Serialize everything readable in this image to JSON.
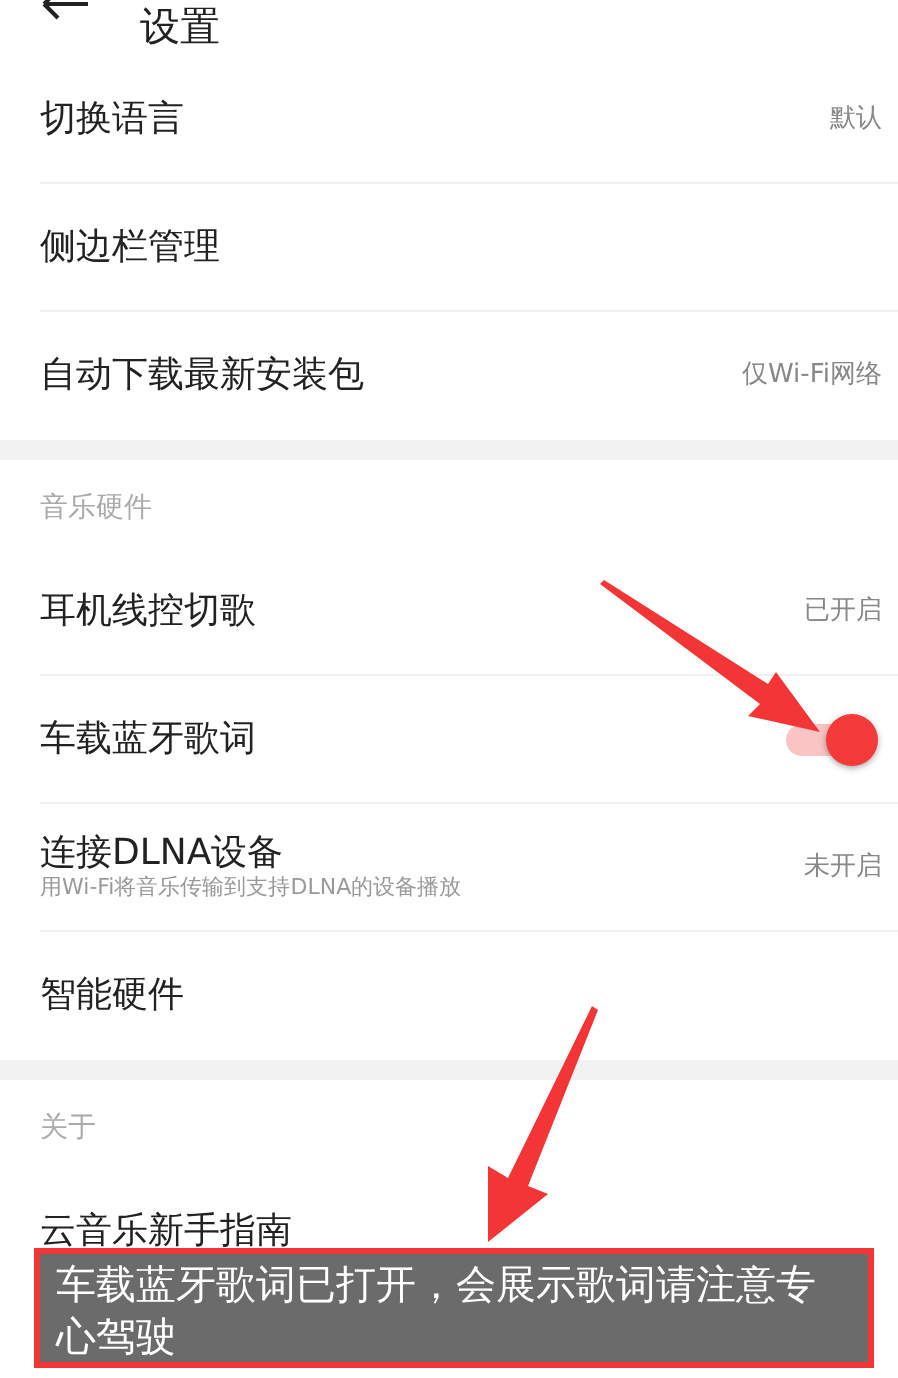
{
  "header": {
    "title": "设置"
  },
  "sections": [
    {
      "items": [
        {
          "kind": "value",
          "label": "切换语言",
          "value": "默认"
        },
        {
          "kind": "link",
          "label": "侧边栏管理"
        },
        {
          "kind": "value",
          "label": "自动下载最新安装包",
          "value": "仅Wi-Fi网络"
        }
      ]
    },
    {
      "heading": "音乐硬件",
      "items": [
        {
          "kind": "value",
          "label": "耳机线控切歌",
          "value": "已开启"
        },
        {
          "kind": "toggle",
          "label": "车载蓝牙歌词",
          "on": true
        },
        {
          "kind": "value",
          "label": "连接DLNA设备",
          "subtitle": "用Wi-Fi将音乐传输到支持DLNA的设备播放",
          "value": "未开启"
        },
        {
          "kind": "link",
          "label": "智能硬件"
        }
      ]
    },
    {
      "heading": "关于",
      "items": [
        {
          "kind": "link",
          "label": "云音乐新手指南"
        }
      ]
    }
  ],
  "toast": {
    "text": "车载蓝牙歌词已打开，会展示歌词请注意专心驾驶"
  }
}
